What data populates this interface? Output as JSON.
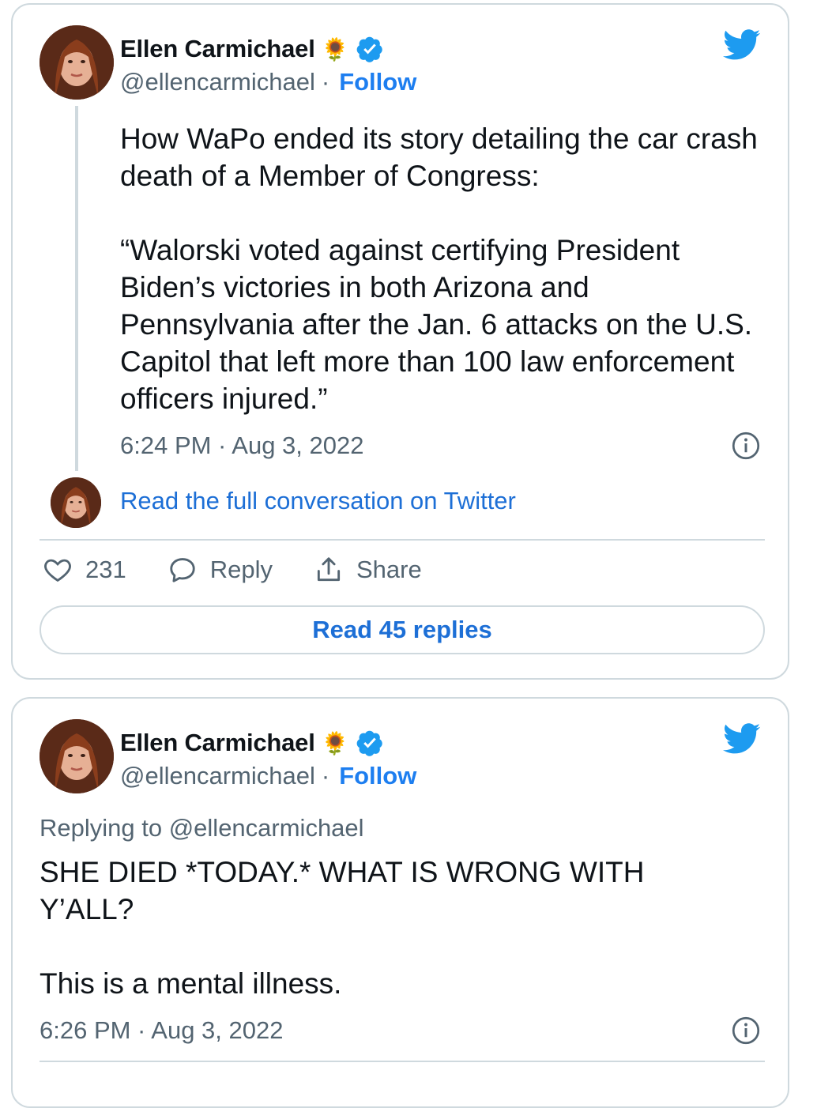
{
  "tweets": [
    {
      "author_name": "Ellen Carmichael",
      "author_emoji": "🌻",
      "handle": "@ellencarmichael",
      "separator": "·",
      "follow_label": "Follow",
      "text_para1": "How WaPo ended its story detailing the car crash death of a Member of Congress:",
      "text_para2": "“Walorski voted against certifying President Biden’s victories in both Arizona and Pennsylvania after the Jan. 6 attacks on the U.S. Capitol that left more than 100 law enforcement officers injured.”",
      "timestamp": "6:24 PM · Aug 3, 2022",
      "read_full_label": "Read the full conversation on Twitter",
      "likes": "231",
      "reply_label": "Reply",
      "share_label": "Share",
      "read_replies_label": "Read 45 replies"
    },
    {
      "author_name": "Ellen Carmichael",
      "author_emoji": "🌻",
      "handle": "@ellencarmichael",
      "separator": "·",
      "follow_label": "Follow",
      "replying_to": "Replying to @ellencarmichael",
      "text_para1": "SHE DIED *TODAY.* WHAT IS WRONG WITH Y’ALL?",
      "text_para2": "This is a mental illness.",
      "timestamp": "6:26 PM · Aug 3, 2022"
    }
  ],
  "icons": {
    "verified": "verified-badge-icon",
    "bird": "twitter-bird-icon",
    "info": "info-icon",
    "heart": "heart-icon",
    "reply": "reply-bubble-icon",
    "share": "share-upload-icon"
  },
  "colors": {
    "link_blue": "#1d6fd6",
    "twitter_blue": "#1d9bf0",
    "muted_text": "#536471",
    "border": "#cfd9de"
  }
}
